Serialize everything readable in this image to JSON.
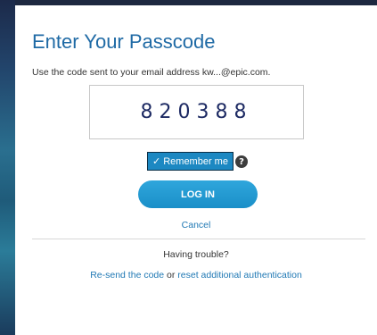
{
  "header": {
    "title": "Enter Your Passcode",
    "subtitle": "Use the code sent to your email address kw...@epic.com."
  },
  "passcode": {
    "value": "820388"
  },
  "remember": {
    "checkmark": "✓",
    "label": "Remember me",
    "checked": true
  },
  "help": {
    "icon": "question-circle-icon",
    "glyph": "?"
  },
  "actions": {
    "login_label": "LOG IN",
    "cancel_label": "Cancel"
  },
  "trouble": {
    "heading": "Having trouble?",
    "resend_label": "Re-send the code",
    "connector": "or",
    "reset_label": "reset additional authentication"
  },
  "colors": {
    "title": "#1f6aa5",
    "accent": "#1a8fc8",
    "link": "#1f78b4",
    "code_text": "#1d2a63"
  }
}
